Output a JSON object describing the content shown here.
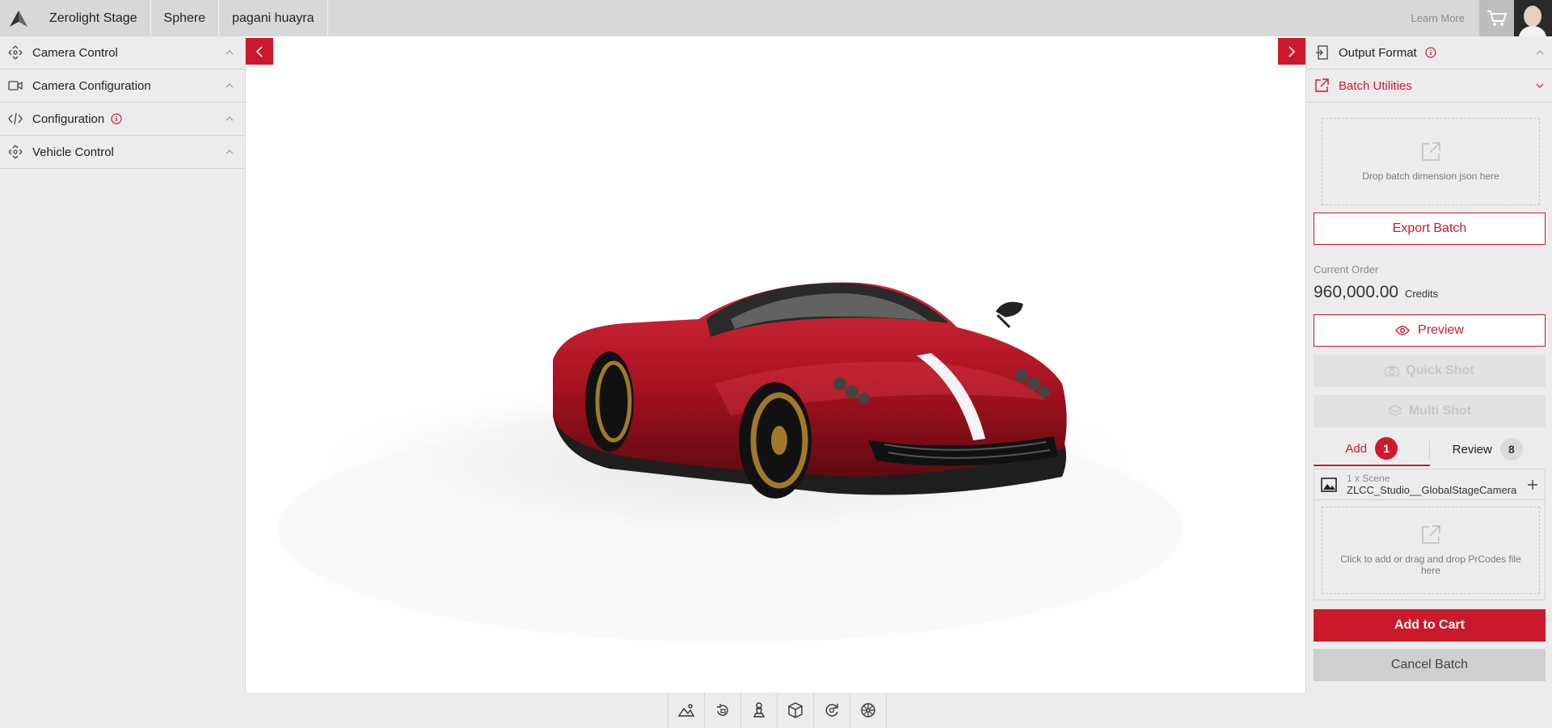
{
  "topbar": {
    "breadcrumbs": [
      "Zerolight Stage",
      "Sphere",
      "pagani huayra"
    ],
    "learn_more": "Learn More"
  },
  "left_panel": {
    "items": [
      {
        "label": "Camera Control",
        "icon": "camera-control-icon",
        "info": false
      },
      {
        "label": "Camera Configuration",
        "icon": "video-camera-icon",
        "info": false
      },
      {
        "label": "Configuration",
        "icon": "code-icon",
        "info": true
      },
      {
        "label": "Vehicle Control",
        "icon": "vehicle-control-icon",
        "info": false
      }
    ]
  },
  "viewport": {
    "car_color": "#b01526"
  },
  "bottom_toolbar": {
    "tools": [
      "environment-icon",
      "rotate-icon",
      "chess-piece-icon",
      "cube-icon",
      "orbit-icon",
      "wheel-icon"
    ]
  },
  "right_panel": {
    "output_format": "Output Format",
    "batch_utilities": "Batch Utilities",
    "drop_batch": "Drop batch dimension json here",
    "export_batch": "Export Batch",
    "current_order_label": "Current Order",
    "current_order_value": "960,000.00",
    "current_order_unit": "Credits",
    "preview": "Preview",
    "quick_shot": "Quick Shot",
    "multi_shot": "Multi Shot",
    "tabs": [
      {
        "label": "Add",
        "count": "1"
      },
      {
        "label": "Review",
        "count": "8"
      }
    ],
    "scene": {
      "count_label": "1 x Scene",
      "name": "ZLCC_Studio__GlobalStageCamera"
    },
    "drop_prcodes": "Click to add or drag and drop PrCodes file here",
    "add_to_cart": "Add to Cart",
    "cancel_batch": "Cancel Batch"
  },
  "colors": {
    "accent": "#cc1a2c",
    "panel_bg": "#ececec",
    "topbar_bg": "#d8d8d8"
  }
}
